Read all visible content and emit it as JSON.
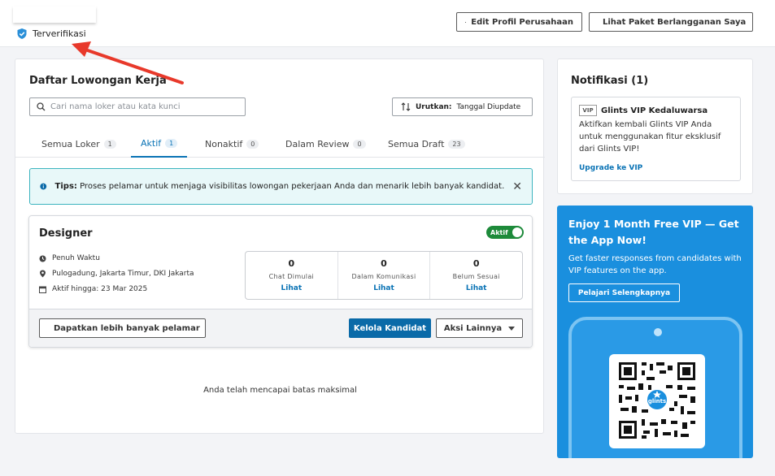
{
  "header": {
    "verified_label": "Terverifikasi",
    "edit_profile_label": "Edit Profil Perusahaan",
    "subscription_label": "Lihat Paket Berlangganan Saya"
  },
  "jobs_panel": {
    "title": "Daftar Lowongan Kerja",
    "search_placeholder": "Cari nama loker atau kata kunci",
    "sort_label": "Urutkan:",
    "sort_value": "Tanggal Diupdate",
    "tabs": [
      {
        "label": "Semua Loker",
        "count": "1"
      },
      {
        "label": "Aktif",
        "count": "1"
      },
      {
        "label": "Nonaktif",
        "count": "0"
      },
      {
        "label": "Dalam Review",
        "count": "0"
      },
      {
        "label": "Semua Draft",
        "count": "23"
      }
    ],
    "tips": {
      "bold": "Tips:",
      "text": "Proses pelamar untuk menjaga visibilitas lowongan pekerjaan Anda dan menarik lebih banyak kandidat."
    },
    "job": {
      "title": "Designer",
      "status": "Aktif",
      "type": "Penuh Waktu",
      "location": "Pulogadung, Jakarta Timur, DKI Jakarta",
      "active_until": "Aktif hingga: 23 Mar 2025",
      "stats": [
        {
          "value": "0",
          "label": "Chat Dimulai",
          "link": "Lihat"
        },
        {
          "value": "0",
          "label": "Dalam Komunikasi",
          "link": "Lihat"
        },
        {
          "value": "0",
          "label": "Belum Sesuai",
          "link": "Lihat"
        }
      ],
      "more_applicants_label": "Dapatkan lebih banyak pelamar",
      "manage_label": "Kelola Kandidat",
      "other_actions_label": "Aksi Lainnya"
    },
    "limit_message": "Anda telah mencapai batas maksimal"
  },
  "notifications": {
    "title": "Notifikasi (1)",
    "item": {
      "icon_text": "VIP",
      "title": "Glints VIP Kedaluwarsa",
      "body": "Aktifkan kembali Glints VIP Anda untuk menggunakan fitur eksklusif dari Glints VIP!",
      "link": "Upgrade ke VIP"
    }
  },
  "promo": {
    "heading": "Enjoy 1 Month Free VIP — Get the App Now!",
    "text": "Get faster responses from candidates with VIP features on the app.",
    "button": "Pelajari Selengkapnya",
    "qr_logo_text": "glints"
  },
  "colors": {
    "primary": "#0a6aa8",
    "link": "#0a73b5",
    "active_badge": "#1d8a3a",
    "tips_bg": "#e8f8f9",
    "promo_bg": "#1a8fde",
    "annotation_arrow": "#e8392b"
  }
}
